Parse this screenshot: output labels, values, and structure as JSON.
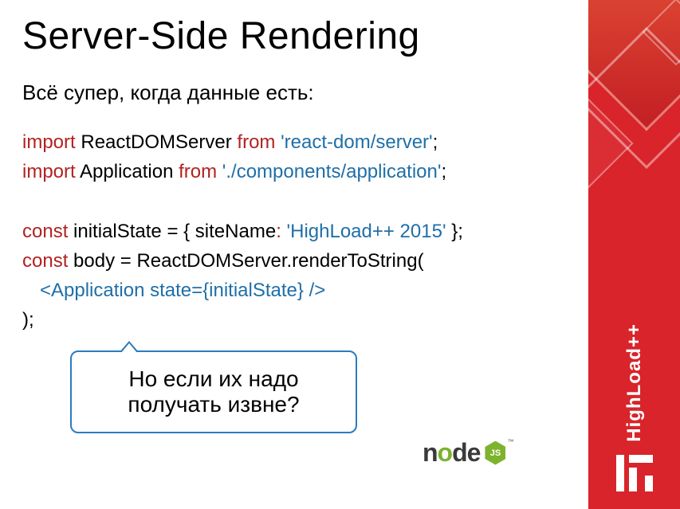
{
  "title": "Server-Side Rendering",
  "subtitle": "Всё супер, когда данные есть:",
  "code": {
    "l1": {
      "import": "import",
      "name": " ReactDOMServer ",
      "from": "from",
      "str": " 'react-dom/server'",
      "end": ";"
    },
    "l2": {
      "import": "import",
      "name": " Application ",
      "from": "from",
      "str": " './components/application'",
      "end": ";"
    },
    "l3": {
      "const": "const",
      "name": " initialState = { siteName",
      "colon": ":",
      "str": " 'HighLoad++ 2015'",
      "end": " };"
    },
    "l4": {
      "const": "const",
      "name": " body = ReactDOMServer.renderToString("
    },
    "l5": {
      "jsx": "<Application state={initialState} />"
    },
    "l6": {
      "end": ");"
    }
  },
  "callout": "Но если их надо получать извне?",
  "node": {
    "n": "n",
    "o": "o",
    "d": "d",
    "e": "e",
    "js": "JS",
    "tm": "™"
  },
  "brand": "HighLoad++"
}
